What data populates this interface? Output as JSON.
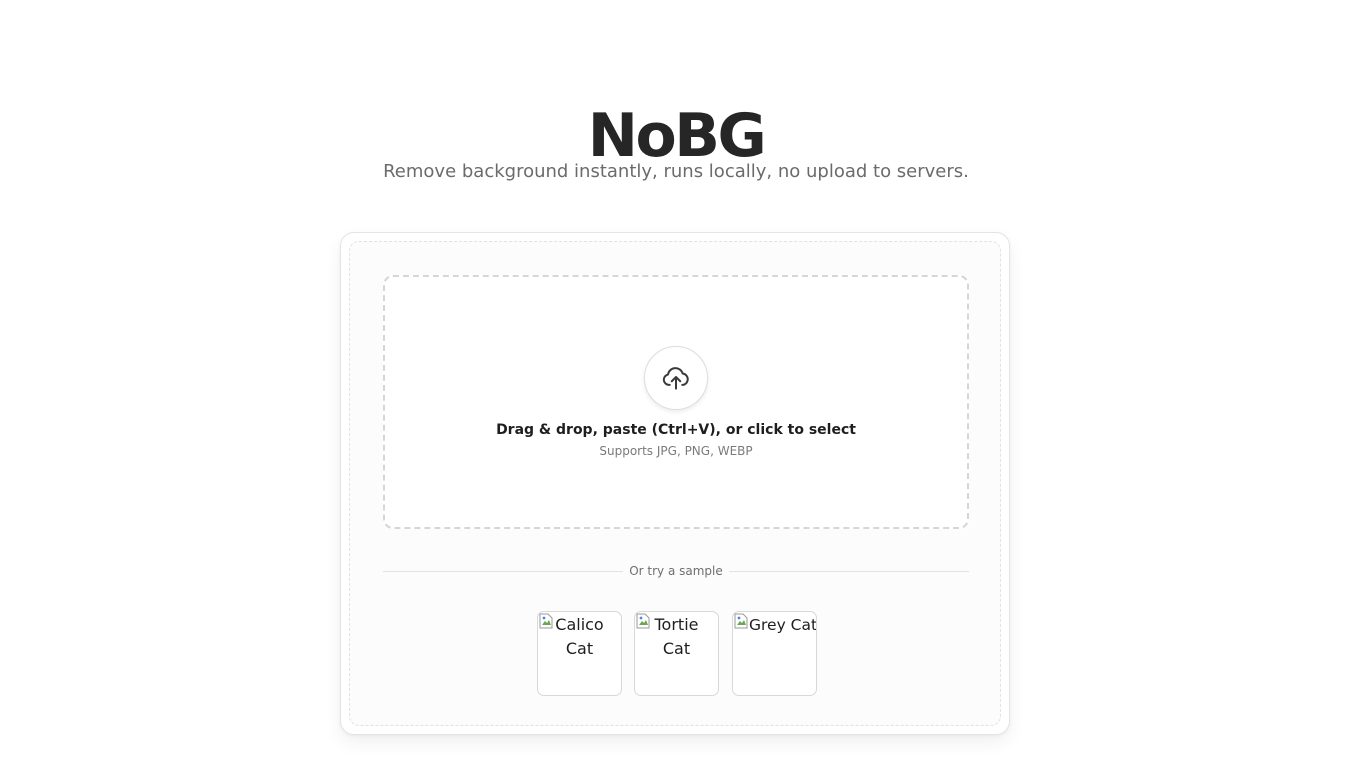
{
  "app": {
    "title": "NoBG",
    "tagline": "Remove background instantly, runs locally, no upload to servers."
  },
  "dropzone": {
    "icon": "cloud-upload-icon",
    "primary_text": "Drag & drop, paste (Ctrl+V), or click to select",
    "secondary_text": "Supports JPG, PNG, WEBP"
  },
  "samples": {
    "divider_label": "Or try a sample",
    "items": [
      {
        "alt": "Calico Cat"
      },
      {
        "alt": "Tortie Cat"
      },
      {
        "alt": "Grey Cat"
      }
    ]
  },
  "colors": {
    "title": "#262626",
    "subtitle": "#6b6b6b",
    "border": "#d6d6d6",
    "background": "#ffffff"
  }
}
